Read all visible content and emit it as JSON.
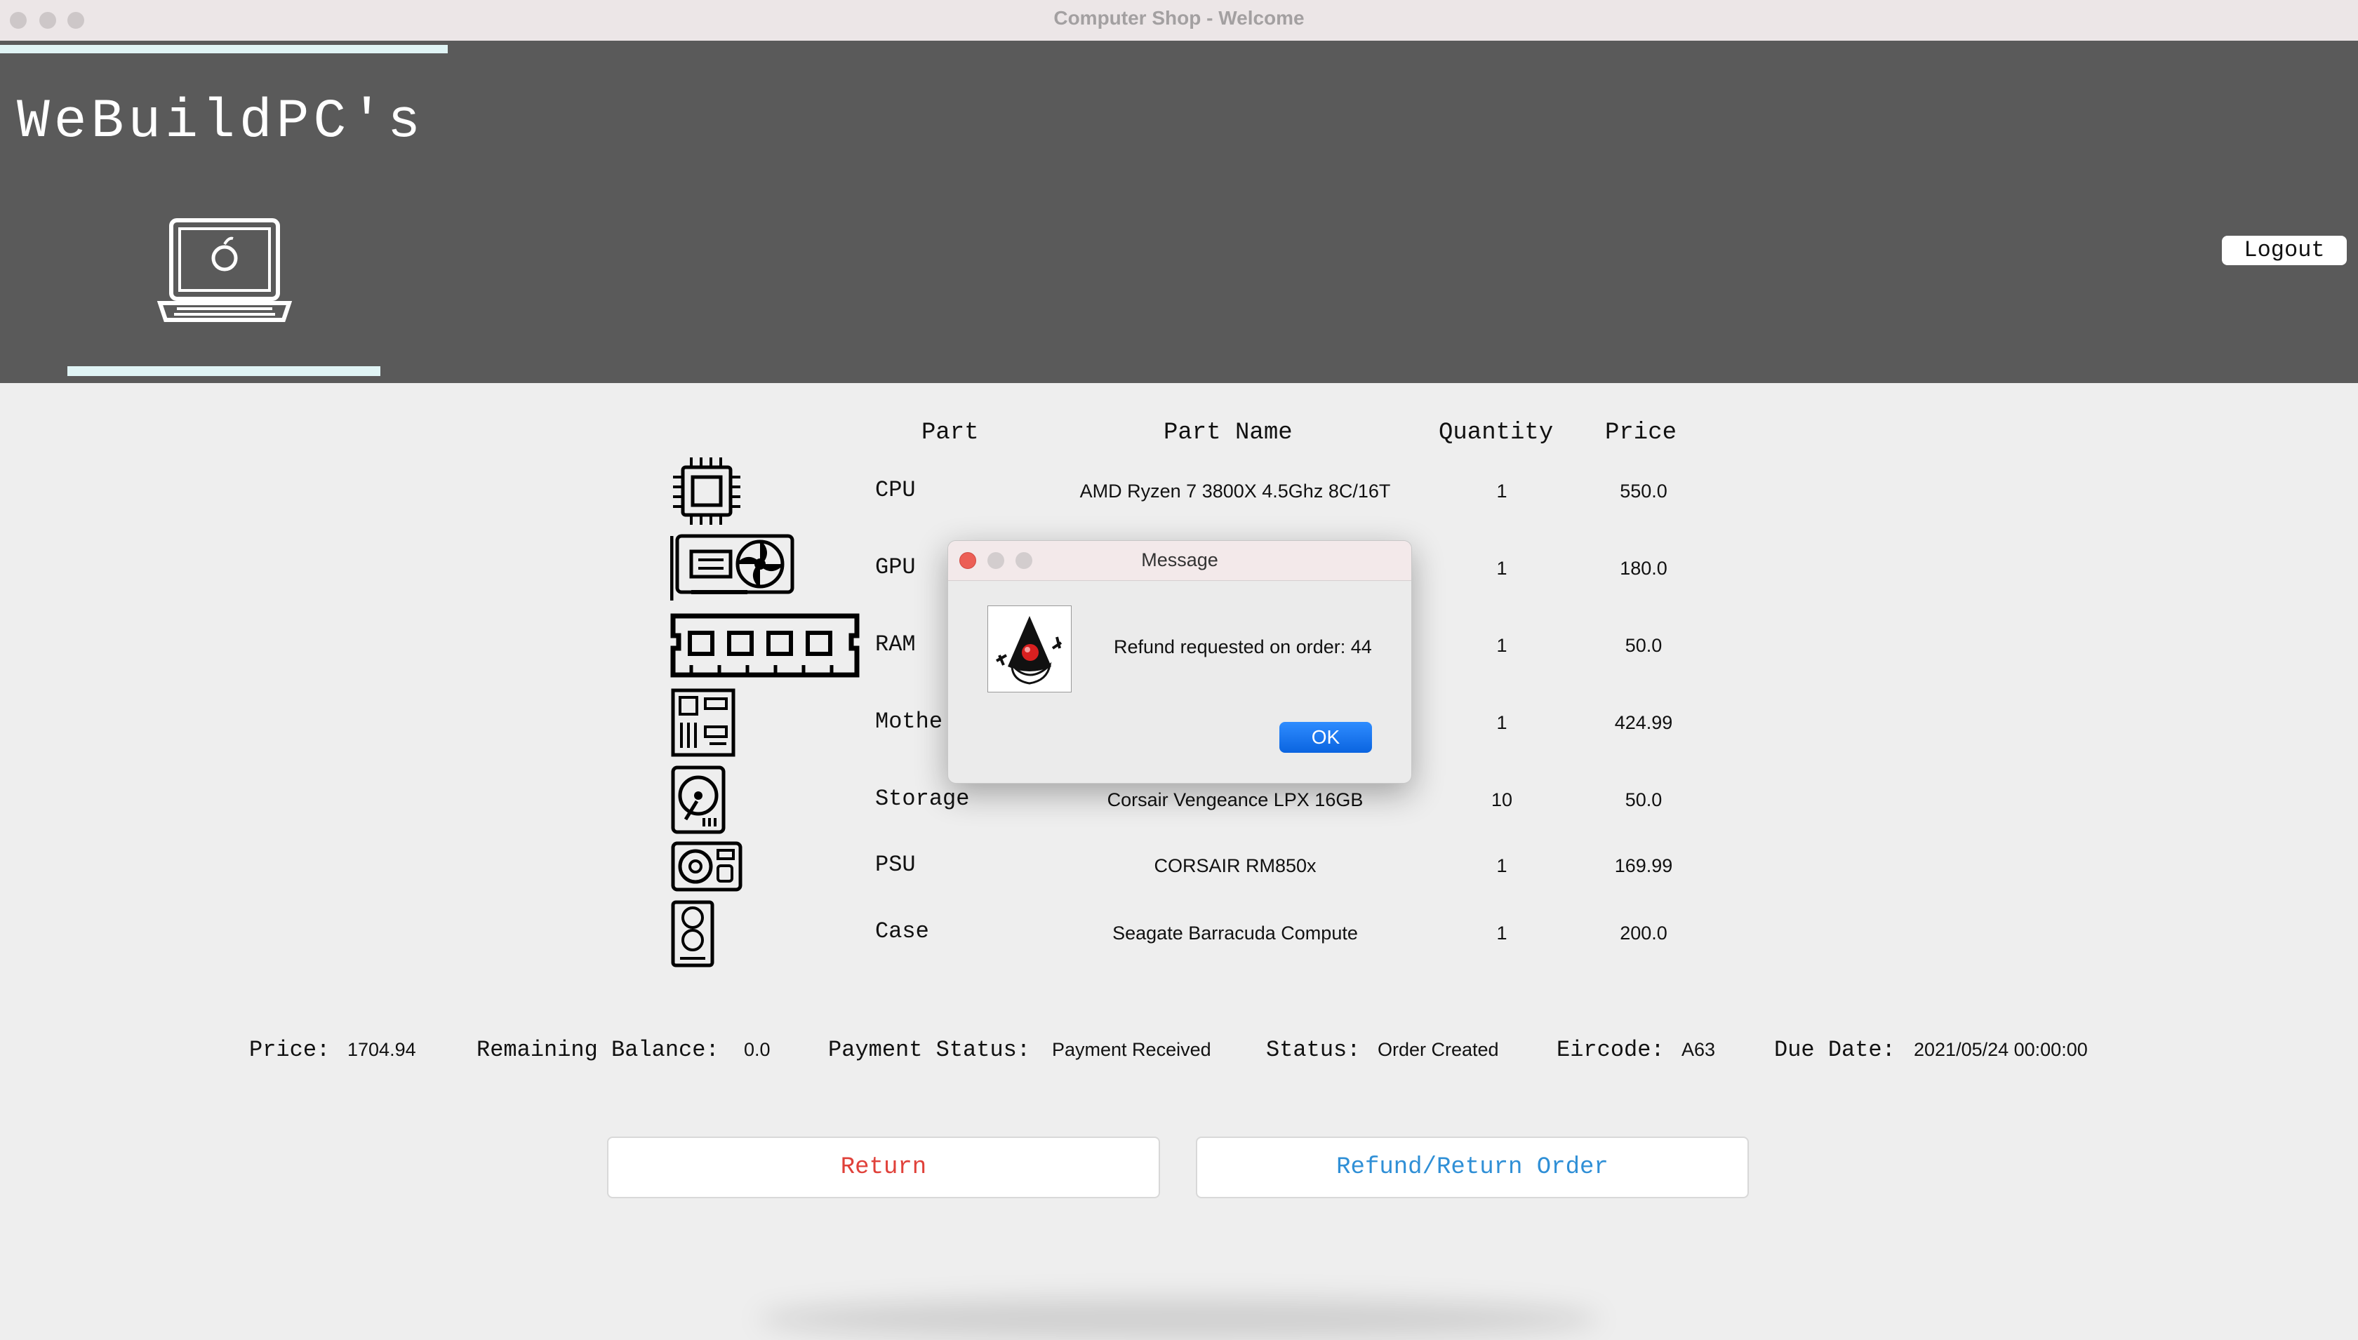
{
  "window": {
    "title": "Computer Shop - Welcome"
  },
  "header": {
    "brand": "WeBuildPC's",
    "logout_label": "Logout"
  },
  "table": {
    "headers": {
      "part": "Part",
      "part_name": "Part Name",
      "quantity": "Quantity",
      "price": "Price"
    },
    "rows": [
      {
        "part": "CPU",
        "icon": "cpu-icon",
        "name": "AMD Ryzen 7 3800X 4.5Ghz 8C/16T",
        "quantity": "1",
        "price": "550.0"
      },
      {
        "part": "GPU",
        "icon": "gpu-icon",
        "name": "",
        "quantity": "1",
        "price": "180.0"
      },
      {
        "part": "RAM",
        "icon": "ram-icon",
        "name": "",
        "quantity": "1",
        "price": "50.0"
      },
      {
        "part": "Mothe",
        "icon": "motherboard-icon",
        "name": "",
        "quantity": "1",
        "price": "424.99"
      },
      {
        "part": "Storage",
        "icon": "storage-icon",
        "name": "Corsair Vengeance LPX 16GB",
        "quantity": "10",
        "price": "50.0"
      },
      {
        "part": "PSU",
        "icon": "psu-icon",
        "name": "CORSAIR RM850x",
        "quantity": "1",
        "price": "169.99"
      },
      {
        "part": "Case",
        "icon": "case-icon",
        "name": "Seagate Barracuda Compute",
        "quantity": "1",
        "price": "200.0"
      }
    ]
  },
  "summary": {
    "price_label": "Price:",
    "price_value": "1704.94",
    "balance_label": "Remaining Balance:",
    "balance_value": "0.0",
    "payment_label": "Payment Status:",
    "payment_value": "Payment Received",
    "status_label": "Status:",
    "status_value": "Order Created",
    "eircode_label": "Eircode:",
    "eircode_value": "A63",
    "due_label": "Due Date:",
    "due_value": "2021/05/24 00:00:00"
  },
  "actions": {
    "return_label": "Return",
    "return_color": "#e0413a",
    "refund_label": "Refund/Return Order",
    "refund_color": "#2f8fd6"
  },
  "dialog": {
    "title": "Message",
    "message": "Refund requested on order: 44",
    "ok_label": "OK",
    "icon": "java-duke-icon"
  }
}
